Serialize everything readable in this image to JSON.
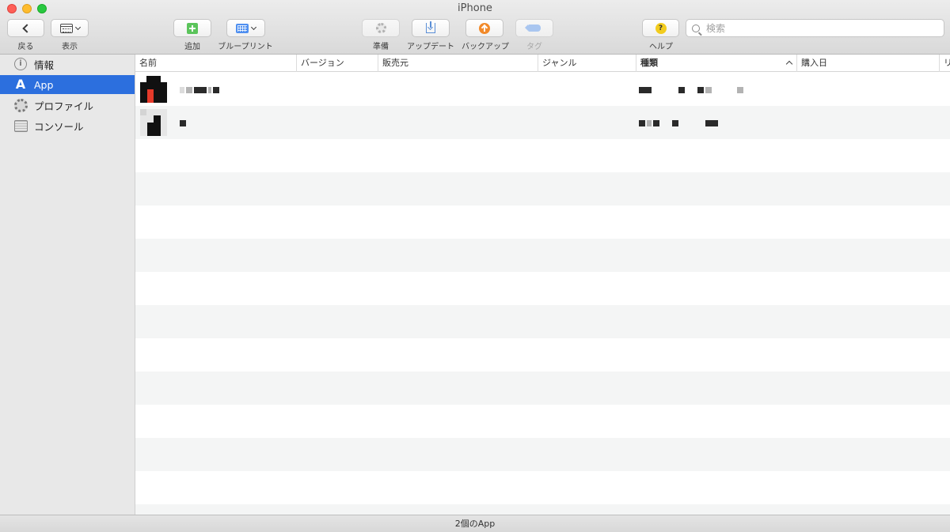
{
  "window": {
    "title": "iPhone"
  },
  "toolbar": {
    "back_label": "戻る",
    "view_label": "表示",
    "add_label": "追加",
    "blueprint_label": "ブループリント",
    "prepare_label": "準備",
    "update_label": "アップデート",
    "backup_label": "バックアップ",
    "tag_label": "タグ",
    "help_label": "ヘルプ",
    "search_placeholder": "検索"
  },
  "sidebar": {
    "items": [
      {
        "label": "情報",
        "icon": "info-icon",
        "selected": false
      },
      {
        "label": "App",
        "icon": "app-store-icon",
        "selected": true
      },
      {
        "label": "プロファイル",
        "icon": "profile-gear-icon",
        "selected": false
      },
      {
        "label": "コンソール",
        "icon": "console-icon",
        "selected": false
      }
    ]
  },
  "table": {
    "columns": [
      {
        "label": "名前"
      },
      {
        "label": "バージョン"
      },
      {
        "label": "販売元"
      },
      {
        "label": "ジャンル"
      },
      {
        "label": "種類",
        "sorted": "ascending"
      },
      {
        "label": "購入日"
      },
      {
        "label": "リ"
      }
    ],
    "rows": [
      {
        "name": "",
        "version": "",
        "publisher": "",
        "genre": "",
        "kind": "",
        "purchase_date": "",
        "redacted": true
      },
      {
        "name": "",
        "version": "",
        "publisher": "",
        "genre": "",
        "kind": "",
        "purchase_date": "",
        "redacted": true
      }
    ]
  },
  "status": {
    "text": "2個のApp"
  },
  "colors": {
    "selection": "#2c6fde",
    "toolbar_bg": "#e0e0e0",
    "sidebar_bg": "#e8e8e8",
    "row_alt": "#f4f5f5"
  }
}
